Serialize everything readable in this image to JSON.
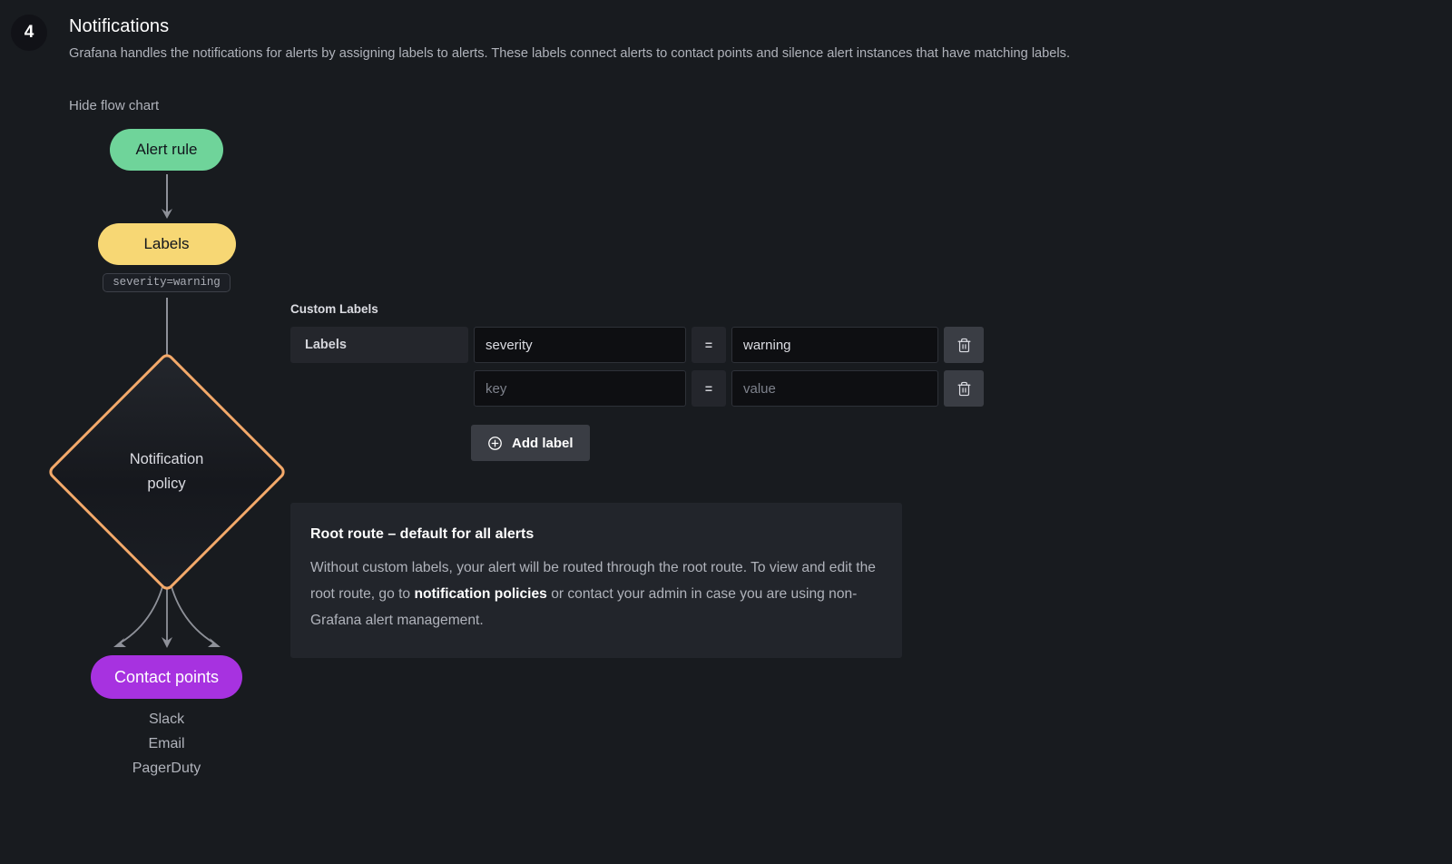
{
  "header": {
    "step_number": "4",
    "title": "Notifications",
    "description": "Grafana handles the notifications for alerts by assigning labels to alerts. These labels connect alerts to contact points and silence alert instances that have matching labels.",
    "flowchart_toggle": "Hide flow chart"
  },
  "flowchart": {
    "alert_rule_node": "Alert rule",
    "labels_node": "Labels",
    "labels_tag": "severity=warning",
    "policy_node_line1": "Notification",
    "policy_node_line2": "policy",
    "contact_points_node": "Contact points",
    "contact_points": [
      "Slack",
      "Email",
      "PagerDuty"
    ],
    "colors": {
      "alert_rule": "#6fd49a",
      "labels": "#f7d774",
      "notification_policy_border": "#f3a96a",
      "contact_points": "#a732e0",
      "arrow": "#8e9199"
    }
  },
  "custom_labels": {
    "section_title": "Custom Labels",
    "row_prefix_label": "Labels",
    "equals_symbol": "=",
    "rows": [
      {
        "key_value": "severity",
        "key_placeholder": "key",
        "value_value": "warning",
        "value_placeholder": "value"
      },
      {
        "key_value": "",
        "key_placeholder": "key",
        "value_value": "",
        "value_placeholder": "value"
      }
    ],
    "add_label_button": "Add label"
  },
  "info_panel": {
    "title": "Root route – default for all alerts",
    "body_part1": "Without custom labels, your alert will be routed through the root route. To view and edit the root route, go to ",
    "link_text": "notification policies",
    "body_part2": " or contact your admin in case you are using non-Grafana alert management."
  }
}
